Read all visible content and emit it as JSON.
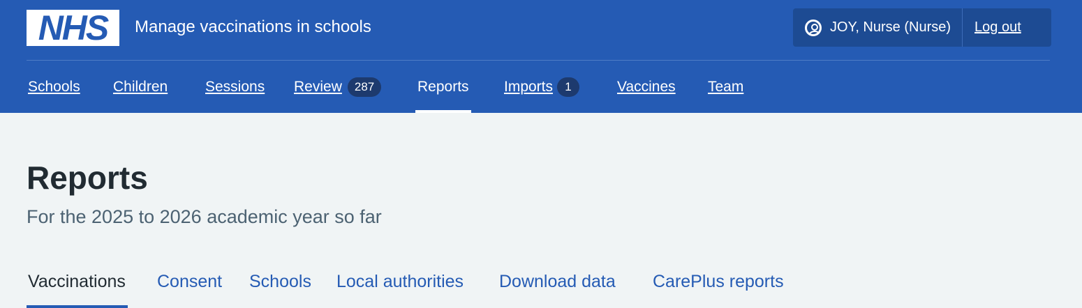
{
  "header": {
    "logo_text": "NHS",
    "service_name": "Manage vaccinations in schools",
    "account": {
      "user_icon": "user-circle-icon",
      "user_name": "JOY, Nurse (Nurse)",
      "logout_label": "Log out"
    },
    "nav": [
      {
        "label": "Schools"
      },
      {
        "label": "Children"
      },
      {
        "label": "Sessions"
      },
      {
        "label": "Review",
        "count": "287"
      },
      {
        "label": "Reports",
        "active": true
      },
      {
        "label": "Imports",
        "count": "1"
      },
      {
        "label": "Vaccines"
      },
      {
        "label": "Team"
      }
    ]
  },
  "main": {
    "title": "Reports",
    "caption": "For the 2025 to 2026 academic year so far",
    "tabs": [
      {
        "label": "Vaccinations",
        "selected": true
      },
      {
        "label": "Consent"
      },
      {
        "label": "Schools"
      },
      {
        "label": "Local authorities"
      },
      {
        "label": "Download data"
      },
      {
        "label": "CarePlus reports"
      }
    ]
  },
  "colors": {
    "brand_blue": "#255bb4",
    "account_bg": "#1d4b93",
    "count_bg": "#1d3a6e",
    "page_bg": "#f0f4f5",
    "text": "#212b32",
    "secondary_text": "#4c6272"
  }
}
